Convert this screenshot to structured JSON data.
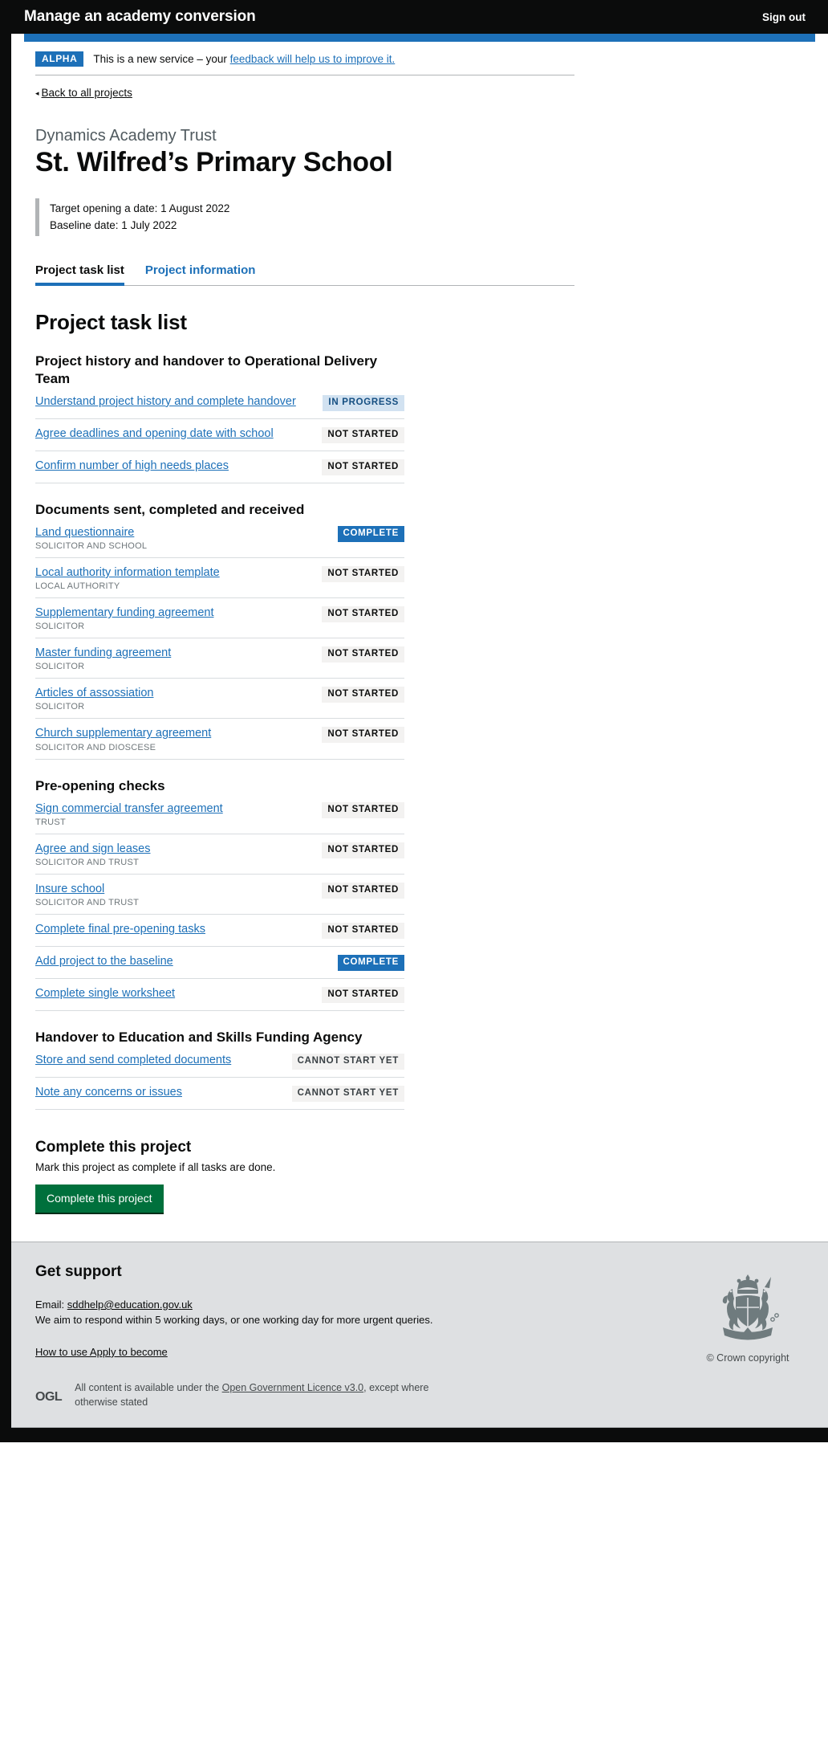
{
  "header": {
    "service_name": "Manage an academy conversion",
    "sign_out": "Sign out"
  },
  "phase_banner": {
    "tag": "ALPHA",
    "text_before": "This is a new service – your ",
    "link": "feedback will help us to improve it."
  },
  "back_link": {
    "arrow": "◂",
    "label": "Back to all projects"
  },
  "heading": {
    "trust": "Dynamics Academy Trust",
    "school": "St. Wilfred’s Primary School"
  },
  "inset": {
    "target_date": "Target opening a date: 1 August 2022",
    "baseline_date": "Baseline date: 1 July 2022"
  },
  "tabs": [
    {
      "label": "Project task list",
      "selected": true
    },
    {
      "label": "Project information",
      "selected": false
    }
  ],
  "page_title": "Project task list",
  "sections": [
    {
      "heading": "Project history and handover to Operational Delivery Team",
      "tasks": [
        {
          "label": "Understand project history and complete handover",
          "sub": "",
          "status": "IN PROGRESS",
          "status_type": "in-progress"
        },
        {
          "label": "Agree deadlines and opening date with school",
          "sub": "",
          "status": "NOT STARTED",
          "status_type": "not-started"
        },
        {
          "label": "Confirm number of high needs places",
          "sub": "",
          "status": "NOT STARTED",
          "status_type": "not-started"
        }
      ]
    },
    {
      "heading": "Documents sent, completed and received",
      "tasks": [
        {
          "label": "Land questionnaire",
          "sub": "SOLICITOR AND SCHOOL",
          "status": "COMPLETE",
          "status_type": "complete"
        },
        {
          "label": "Local authority information template",
          "sub": "LOCAL AUTHORITY",
          "status": "NOT STARTED",
          "status_type": "not-started"
        },
        {
          "label": "Supplementary funding agreement",
          "sub": "SOLICITOR",
          "status": "NOT STARTED",
          "status_type": "not-started"
        },
        {
          "label": "Master funding agreement",
          "sub": "SOLICITOR",
          "status": "NOT STARTED",
          "status_type": "not-started"
        },
        {
          "label": "Articles of assossiation",
          "sub": "SOLICITOR",
          "status": "NOT STARTED",
          "status_type": "not-started"
        },
        {
          "label": "Church supplementary agreement",
          "sub": "SOLICITOR AND DIOSCESE",
          "status": "NOT STARTED",
          "status_type": "not-started"
        }
      ]
    },
    {
      "heading": "Pre-opening checks",
      "tasks": [
        {
          "label": "Sign commercial transfer agreement",
          "sub": "TRUST",
          "status": "NOT STARTED",
          "status_type": "not-started"
        },
        {
          "label": "Agree and sign leases",
          "sub": "SOLICITOR AND TRUST",
          "status": "NOT STARTED",
          "status_type": "not-started"
        },
        {
          "label": "Insure school",
          "sub": "SOLICITOR AND TRUST",
          "status": "NOT STARTED",
          "status_type": "not-started"
        },
        {
          "label": "Complete final pre-opening tasks",
          "sub": "",
          "status": "NOT STARTED",
          "status_type": "not-started"
        },
        {
          "label": "Add project to the baseline",
          "sub": "",
          "status": "COMPLETE",
          "status_type": "complete"
        },
        {
          "label": "Complete single worksheet",
          "sub": "",
          "status": "NOT STARTED",
          "status_type": "not-started"
        }
      ]
    },
    {
      "heading": "Handover to Education and Skills Funding Agency",
      "tasks": [
        {
          "label": "Store and send completed documents",
          "sub": "",
          "status": "CANNOT START YET",
          "status_type": "cannot-start"
        },
        {
          "label": "Note any concerns or issues",
          "sub": "",
          "status": "CANNOT START YET",
          "status_type": "cannot-start"
        }
      ]
    }
  ],
  "complete_project": {
    "heading": "Complete this project",
    "description": "Mark this project as complete if all tasks are done.",
    "button_label": "Complete this project"
  },
  "footer": {
    "heading": "Get support",
    "email_label": "Email: ",
    "email": "sddhelp@education.gov.uk",
    "response_text": "We aim to respond within 5 working days, or one working day for more urgent queries.",
    "how_to_link": "How to use Apply to become",
    "crown_caption": "© Crown copyright",
    "ogl_logo": "OGL",
    "licence_before": "All content is available under the ",
    "licence_link": "Open Government Licence v3.0",
    "licence_after": ", except where otherwise stated"
  },
  "colors": {
    "brand_blue": "#1d70b8",
    "black": "#0b0c0c",
    "green": "#00703c",
    "grey_footer": "#dee0e2",
    "tag_grey": "#f3f2f1",
    "tag_blue_bg": "#d2e2f1",
    "tag_blue_text": "#144e81"
  }
}
